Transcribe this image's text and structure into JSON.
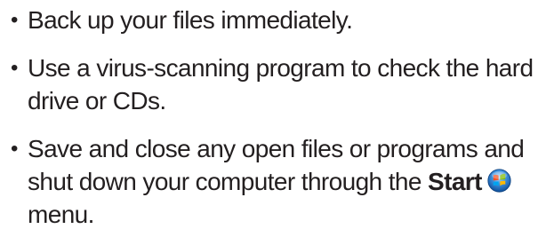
{
  "bullet_char": "•",
  "items": [
    {
      "text": "Back up your files immediately."
    },
    {
      "text": "Use a virus-scanning program to check the hard drive or CDs."
    },
    {
      "text_before": "Save and close any open files or programs and shut down your computer through the",
      "bold_word": "Start",
      "icon": "windows-start-orb-icon",
      "text_after": "menu."
    }
  ],
  "colors": {
    "text": "#231f20",
    "orb_blue": "#2a7fd4",
    "orb_rim": "#6fb4ee"
  }
}
